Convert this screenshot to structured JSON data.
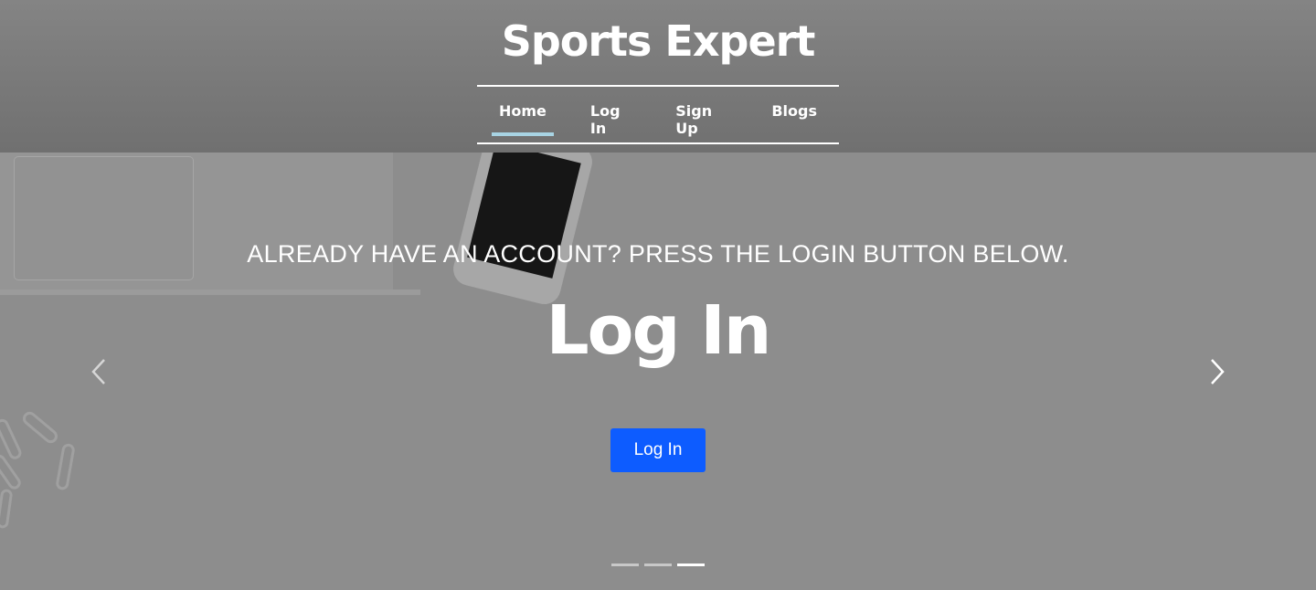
{
  "header": {
    "brand": "Sports Expert",
    "nav": [
      {
        "label": "Home",
        "active": true
      },
      {
        "label": "Log In",
        "active": false
      },
      {
        "label": "Sign Up",
        "active": false
      },
      {
        "label": "Blogs",
        "active": false
      }
    ],
    "active_underline_color": "#a8d4e4"
  },
  "hero": {
    "subtitle": "ALREADY HAVE AN ACCOUNT? PRESS THE LOGIN BUTTON BELOW.",
    "title": "Log In",
    "button_label": "Log In",
    "button_color": "#0d5cff",
    "prev_icon": "chevron-left-icon",
    "next_icon": "chevron-right-icon",
    "slide_count": 3,
    "active_slide": 3
  }
}
